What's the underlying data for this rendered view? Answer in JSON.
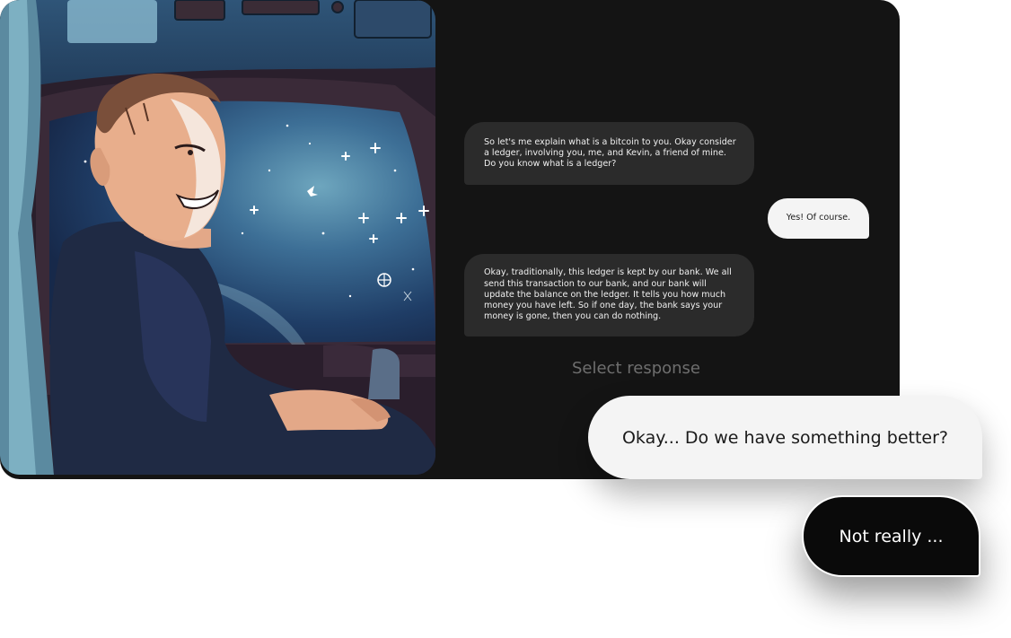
{
  "chat": {
    "messages": [
      {
        "from": "npc",
        "text": "So let's me explain what is a bitcoin to you. Okay consider a ledger, involving you, me, and Kevin, a friend of mine. Do you know what is a ledger?"
      },
      {
        "from": "player",
        "text": "Yes! Of course."
      },
      {
        "from": "npc",
        "text": "Okay, traditionally, this ledger is kept by our bank. We all send this transaction to our bank, and our bank will update the balance on the ledger. It tells you how much money you have left. So if one day, the bank says your money is gone, then you can do nothing."
      }
    ],
    "select_label": "Select response"
  },
  "responses": [
    {
      "label": "Okay... Do we have something better?"
    },
    {
      "label": "Not really ..."
    }
  ],
  "colors": {
    "card_bg": "#141414",
    "npc_bubble": "#2b2b2b",
    "player_bubble": "#f4f4f4",
    "primary_option": "#f4f4f4",
    "secondary_option": "#0a0a0a"
  }
}
